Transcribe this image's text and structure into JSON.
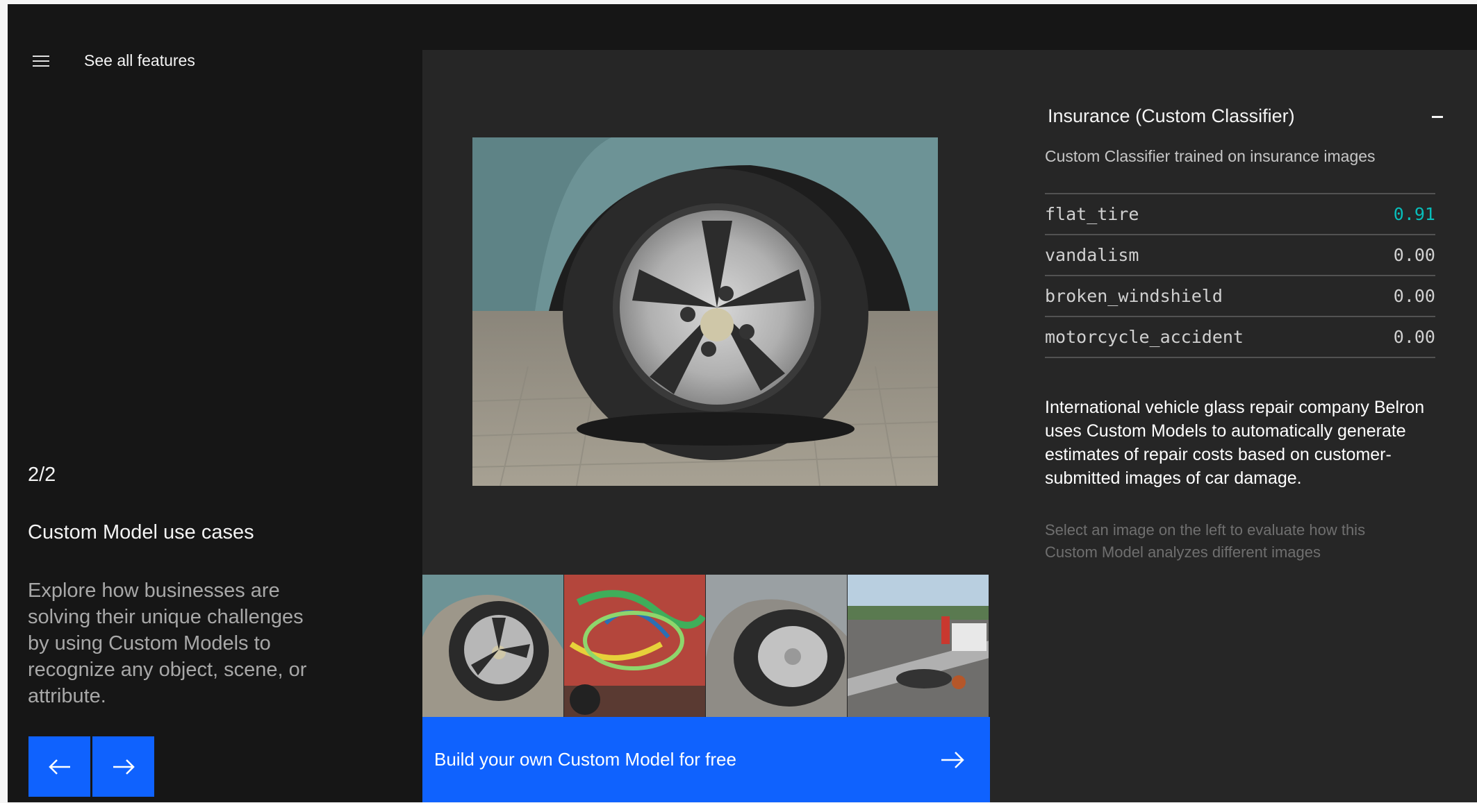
{
  "nav": {
    "see_all_label": "See all features"
  },
  "left": {
    "counter": "2/2",
    "title": "Custom Model use cases",
    "description": "Explore how businesses are solving their unique challenges by using Custom Models to recognize any object, scene, or attribute."
  },
  "icons": {
    "menu": "hamburger-icon",
    "prev": "arrow-left-icon",
    "next": "arrow-right-icon",
    "cta": "arrow-right-icon",
    "collapse": "minus-icon"
  },
  "gallery": {
    "main_image": "flat-tire-photo",
    "thumbnails": [
      "flat-tire-thumbnail",
      "vandalism-thumbnail",
      "flat-tire-closeup-thumbnail",
      "motorcycle-accident-thumbnail"
    ],
    "cta_label": "Build your own Custom Model for free"
  },
  "panel": {
    "title": "Insurance (Custom Classifier)",
    "subtitle": "Custom Classifier trained on insurance images",
    "results": [
      {
        "label": "flat_tire",
        "score": "0.91"
      },
      {
        "label": "vandalism",
        "score": "0.00"
      },
      {
        "label": "broken_windshield",
        "score": "0.00"
      },
      {
        "label": "motorcycle_accident",
        "score": "0.00"
      }
    ],
    "case_study": "International vehicle glass repair company Belron uses Custom Models to automatically generate estimates of repair costs based on customer-submitted images of car damage.",
    "hint": "Select an image on the left to evaluate how this Custom Model analyzes different images"
  },
  "colors": {
    "accent": "#0f62fe",
    "score_highlight": "#08bdba",
    "background": "#161616",
    "panel": "#262626"
  }
}
